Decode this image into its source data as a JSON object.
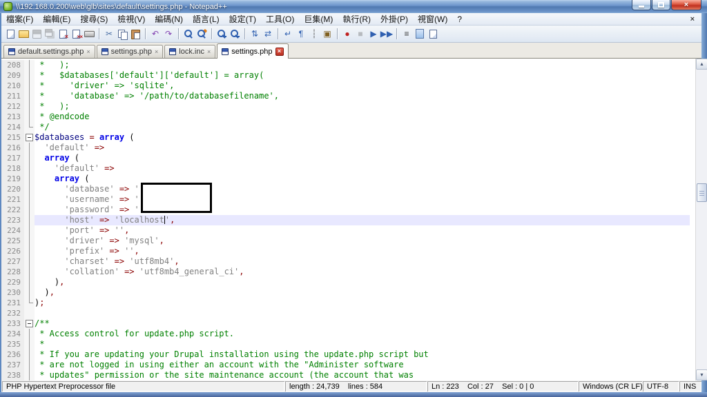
{
  "window": {
    "title": "\\\\192.168.0.200\\web\\glb\\sites\\default\\settings.php - Notepad++",
    "close_glyph": "×"
  },
  "menu": {
    "items": [
      "檔案(F)",
      "編輯(E)",
      "搜尋(S)",
      "檢視(V)",
      "編碼(N)",
      "語言(L)",
      "設定(T)",
      "工具(O)",
      "巨集(M)",
      "執行(R)",
      "外掛(P)",
      "視窗(W)",
      "?"
    ],
    "close_label": "×"
  },
  "toolbar": {
    "items": [
      {
        "name": "new-file",
        "cls": "ic-page"
      },
      {
        "name": "open-file",
        "cls": "ic-folder"
      },
      {
        "name": "save-file",
        "cls": "ic-floppy",
        "disabled": true
      },
      {
        "name": "save-all",
        "cls": "ic-floppy2",
        "disabled": true
      },
      {
        "name": "close-file",
        "cls": "ic-page ic-x"
      },
      {
        "name": "close-all",
        "cls": "ic-page ic-xx"
      },
      {
        "name": "print",
        "cls": "ic-printer"
      },
      {
        "sep": true
      },
      {
        "name": "cut",
        "glyph": "✂",
        "color": "#4A6FA5"
      },
      {
        "name": "copy",
        "cls": "ic-copy"
      },
      {
        "name": "paste",
        "cls": "ic-paste"
      },
      {
        "sep": true
      },
      {
        "name": "undo",
        "glyph": "↶",
        "color": "#8040B0"
      },
      {
        "name": "redo",
        "glyph": "↷",
        "color": "#8040B0"
      },
      {
        "sep": true
      },
      {
        "name": "find",
        "cls": "ic-mag"
      },
      {
        "name": "replace",
        "cls": "ic-mag ic-mag-r"
      },
      {
        "sep": true
      },
      {
        "name": "zoom-in",
        "cls": "ic-mag ic-plus"
      },
      {
        "name": "zoom-out",
        "cls": "ic-mag ic-minus"
      },
      {
        "sep": true
      },
      {
        "name": "sync-vertical",
        "glyph": "⇅",
        "color": "#3060B0"
      },
      {
        "name": "sync-horizontal",
        "glyph": "⇄",
        "color": "#3060B0"
      },
      {
        "sep": true
      },
      {
        "name": "word-wrap",
        "glyph": "↵",
        "color": "#3060B0"
      },
      {
        "name": "show-all-characters",
        "glyph": "¶",
        "color": "#3060B0"
      },
      {
        "name": "indent-guide",
        "glyph": "┆",
        "color": "#606060"
      },
      {
        "name": "user-define-dialog",
        "glyph": "▣",
        "color": "#806020"
      },
      {
        "sep": true
      },
      {
        "name": "record-macro",
        "glyph": "●",
        "color": "#C02020"
      },
      {
        "name": "stop-recording",
        "glyph": "■",
        "color": "#3060B0",
        "disabled": true
      },
      {
        "name": "play-macro",
        "glyph": "▶",
        "color": "#3060B0"
      },
      {
        "name": "run-macro-multiple",
        "glyph": "▶▶",
        "color": "#3060B0"
      },
      {
        "sep": true
      },
      {
        "name": "function-list",
        "glyph": "≡",
        "color": "#404040"
      },
      {
        "name": "document-map",
        "cls": "ic-map"
      },
      {
        "name": "document-list",
        "cls": "ic-page"
      }
    ]
  },
  "tabs": [
    {
      "label": "default.settings.php",
      "active": false,
      "close": "×"
    },
    {
      "label": "settings.php",
      "active": false,
      "close": "×"
    },
    {
      "label": "lock.inc",
      "active": false,
      "close": "×"
    },
    {
      "label": "settings.php",
      "active": true,
      "close": "×"
    }
  ],
  "scrollbar": {
    "up": "▲",
    "down": "▼"
  },
  "editor": {
    "lines": [
      {
        "n": 208,
        "fold": "line",
        "tokens": [
          {
            "t": " *   );",
            "c": "cm"
          }
        ]
      },
      {
        "n": 209,
        "fold": "line",
        "tokens": [
          {
            "t": " *   $databases['default']['default'] = array(",
            "c": "cm"
          }
        ]
      },
      {
        "n": 210,
        "fold": "line",
        "tokens": [
          {
            "t": " *     'driver' => 'sqlite',",
            "c": "cm"
          }
        ]
      },
      {
        "n": 211,
        "fold": "line",
        "tokens": [
          {
            "t": " *     'database' => '/path/to/databasefilename',",
            "c": "cm"
          }
        ]
      },
      {
        "n": 212,
        "fold": "line",
        "tokens": [
          {
            "t": " *   );",
            "c": "cm"
          }
        ]
      },
      {
        "n": 213,
        "fold": "line",
        "tokens": [
          {
            "t": " * @endcode",
            "c": "cm"
          }
        ]
      },
      {
        "n": 214,
        "fold": "end",
        "tokens": [
          {
            "t": " */",
            "c": "cm"
          }
        ]
      },
      {
        "n": 215,
        "fold": "minus",
        "tokens": [
          {
            "t": "$databases",
            "c": "var"
          },
          {
            "t": " = ",
            "c": "op"
          },
          {
            "t": "array",
            "c": "kw"
          },
          {
            "t": " (",
            "c": "pl"
          }
        ]
      },
      {
        "n": 216,
        "fold": "line",
        "tokens": [
          {
            "t": "  ",
            "c": "pl"
          },
          {
            "t": "'default'",
            "c": "str"
          },
          {
            "t": " => ",
            "c": "op"
          }
        ]
      },
      {
        "n": 217,
        "fold": "line",
        "tokens": [
          {
            "t": "  ",
            "c": "pl"
          },
          {
            "t": "array",
            "c": "kw"
          },
          {
            "t": " (",
            "c": "pl"
          }
        ]
      },
      {
        "n": 218,
        "fold": "line",
        "tokens": [
          {
            "t": "    ",
            "c": "pl"
          },
          {
            "t": "'default'",
            "c": "str"
          },
          {
            "t": " => ",
            "c": "op"
          }
        ]
      },
      {
        "n": 219,
        "fold": "line",
        "tokens": [
          {
            "t": "    ",
            "c": "pl"
          },
          {
            "t": "array",
            "c": "kw"
          },
          {
            "t": " (",
            "c": "pl"
          }
        ]
      },
      {
        "n": 220,
        "fold": "line",
        "tokens": [
          {
            "t": "      ",
            "c": "pl"
          },
          {
            "t": "'database'",
            "c": "str"
          },
          {
            "t": " => ",
            "c": "op"
          },
          {
            "t": "'",
            "c": "str"
          }
        ]
      },
      {
        "n": 221,
        "fold": "line",
        "tokens": [
          {
            "t": "      ",
            "c": "pl"
          },
          {
            "t": "'username'",
            "c": "str"
          },
          {
            "t": " => ",
            "c": "op"
          },
          {
            "t": "'",
            "c": "str"
          }
        ]
      },
      {
        "n": 222,
        "fold": "line",
        "tokens": [
          {
            "t": "      ",
            "c": "pl"
          },
          {
            "t": "'password'",
            "c": "str"
          },
          {
            "t": " => ",
            "c": "op"
          },
          {
            "t": "'",
            "c": "str"
          }
        ]
      },
      {
        "n": 223,
        "fold": "line",
        "current": true,
        "tokens": [
          {
            "t": "      ",
            "c": "pl"
          },
          {
            "t": "'host'",
            "c": "str"
          },
          {
            "t": " => ",
            "c": "op"
          },
          {
            "t": "'localhost",
            "c": "str"
          },
          {
            "caret": true
          },
          {
            "t": "'",
            "c": "str"
          },
          {
            "t": ",",
            "c": "op"
          }
        ]
      },
      {
        "n": 224,
        "fold": "line",
        "tokens": [
          {
            "t": "      ",
            "c": "pl"
          },
          {
            "t": "'port'",
            "c": "str"
          },
          {
            "t": " => ",
            "c": "op"
          },
          {
            "t": "''",
            "c": "str"
          },
          {
            "t": ",",
            "c": "op"
          }
        ]
      },
      {
        "n": 225,
        "fold": "line",
        "tokens": [
          {
            "t": "      ",
            "c": "pl"
          },
          {
            "t": "'driver'",
            "c": "str"
          },
          {
            "t": " => ",
            "c": "op"
          },
          {
            "t": "'mysql'",
            "c": "str"
          },
          {
            "t": ",",
            "c": "op"
          }
        ]
      },
      {
        "n": 226,
        "fold": "line",
        "tokens": [
          {
            "t": "      ",
            "c": "pl"
          },
          {
            "t": "'prefix'",
            "c": "str"
          },
          {
            "t": " => ",
            "c": "op"
          },
          {
            "t": "''",
            "c": "str"
          },
          {
            "t": ",",
            "c": "op"
          }
        ]
      },
      {
        "n": 227,
        "fold": "line",
        "tokens": [
          {
            "t": "      ",
            "c": "pl"
          },
          {
            "t": "'charset'",
            "c": "str"
          },
          {
            "t": " => ",
            "c": "op"
          },
          {
            "t": "'utf8mb4'",
            "c": "str"
          },
          {
            "t": ",",
            "c": "op"
          }
        ]
      },
      {
        "n": 228,
        "fold": "line",
        "tokens": [
          {
            "t": "      ",
            "c": "pl"
          },
          {
            "t": "'collation'",
            "c": "str"
          },
          {
            "t": " => ",
            "c": "op"
          },
          {
            "t": "'utf8mb4_general_ci'",
            "c": "str"
          },
          {
            "t": ",",
            "c": "op"
          }
        ]
      },
      {
        "n": 229,
        "fold": "line",
        "tokens": [
          {
            "t": "    )",
            "c": "pl"
          },
          {
            "t": ",",
            "c": "op"
          }
        ]
      },
      {
        "n": 230,
        "fold": "line",
        "tokens": [
          {
            "t": "  )",
            "c": "pl"
          },
          {
            "t": ",",
            "c": "op"
          }
        ]
      },
      {
        "n": 231,
        "fold": "end",
        "tokens": [
          {
            "t": ")",
            "c": "pl"
          },
          {
            "t": ";",
            "c": "op"
          }
        ]
      },
      {
        "n": 232,
        "fold": "",
        "tokens": []
      },
      {
        "n": 233,
        "fold": "minus",
        "tokens": [
          {
            "t": "/**",
            "c": "cm"
          }
        ]
      },
      {
        "n": 234,
        "fold": "line",
        "tokens": [
          {
            "t": " * Access control for update.php script.",
            "c": "cm"
          }
        ]
      },
      {
        "n": 235,
        "fold": "line",
        "tokens": [
          {
            "t": " *",
            "c": "cm"
          }
        ]
      },
      {
        "n": 236,
        "fold": "line",
        "tokens": [
          {
            "t": " * If you are updating your Drupal installation using the update.php script but",
            "c": "cm"
          }
        ]
      },
      {
        "n": 237,
        "fold": "line",
        "tokens": [
          {
            "t": " * are not logged in using either an account with the \"Administer software",
            "c": "cm"
          }
        ]
      },
      {
        "n": 238,
        "fold": "line",
        "tokens": [
          {
            "t": " * updates\" permission or the site maintenance account (the account that was",
            "c": "cm"
          }
        ]
      }
    ]
  },
  "status": {
    "doc_type": "PHP Hypertext Preprocessor file",
    "length_lines": "length : 24,739    lines : 584",
    "position": "Ln : 223    Col : 27    Sel : 0 | 0",
    "eol": "Windows (CR LF)",
    "encoding": "UTF-8",
    "mode": "INS"
  }
}
